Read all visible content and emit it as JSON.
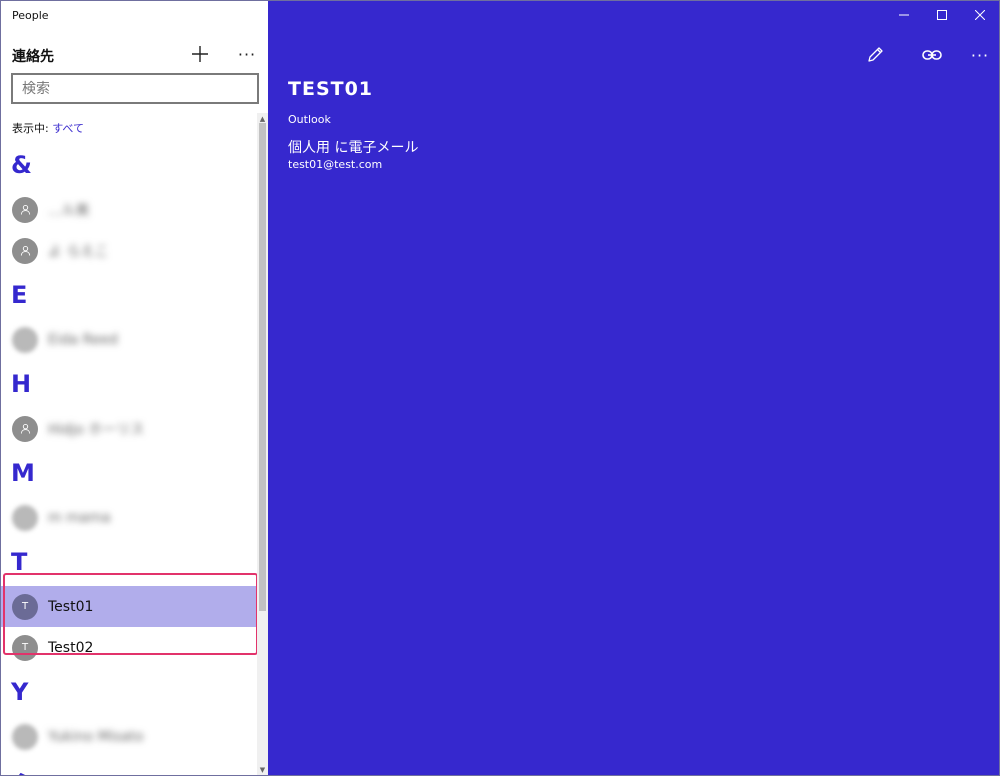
{
  "app": {
    "title": "People"
  },
  "left_pane": {
    "title": "連絡先",
    "search_placeholder": "検索",
    "filter_label": "表示中: ",
    "filter_value": "すべて",
    "groups": [
      {
        "letter": "&",
        "items": [
          {
            "name": "...ル美",
            "initial": "",
            "avatar": "person",
            "blurred": true
          },
          {
            "name": "よ らえこ",
            "initial": "",
            "avatar": "person",
            "blurred": true
          }
        ]
      },
      {
        "letter": "E",
        "items": [
          {
            "name": "Eida Reed",
            "initial": "",
            "avatar": "photo",
            "blurred": true
          }
        ]
      },
      {
        "letter": "H",
        "items": [
          {
            "name": "Hidjo ホーリス",
            "initial": "",
            "avatar": "person",
            "blurred": true
          }
        ]
      },
      {
        "letter": "M",
        "items": [
          {
            "name": "m mama",
            "initial": "",
            "avatar": "photo",
            "blurred": true
          }
        ]
      },
      {
        "letter": "T",
        "items": [
          {
            "name": "Test01",
            "initial": "T",
            "avatar": "initial",
            "blurred": false,
            "selected": true
          },
          {
            "name": "Test02",
            "initial": "T",
            "avatar": "initial",
            "blurred": false
          }
        ]
      },
      {
        "letter": "Y",
        "items": [
          {
            "name": "Yukino Misato",
            "initial": "",
            "avatar": "photo",
            "blurred": true
          }
        ]
      },
      {
        "letter": "ふ",
        "items": []
      }
    ]
  },
  "detail": {
    "name": "TEST01",
    "source": "Outlook",
    "email_label": "個人用 に電子メール",
    "email": "test01@test.com"
  },
  "icons": {
    "add": "plus-icon",
    "more": "more-icon",
    "edit": "pencil-icon",
    "link": "link-icon",
    "minimize": "minimize-icon",
    "maximize": "maximize-icon",
    "close": "close-icon",
    "person": "person-icon"
  },
  "colors": {
    "accent": "#3628ce",
    "selection": "#b1adeb",
    "highlight_border": "#e2336b"
  }
}
